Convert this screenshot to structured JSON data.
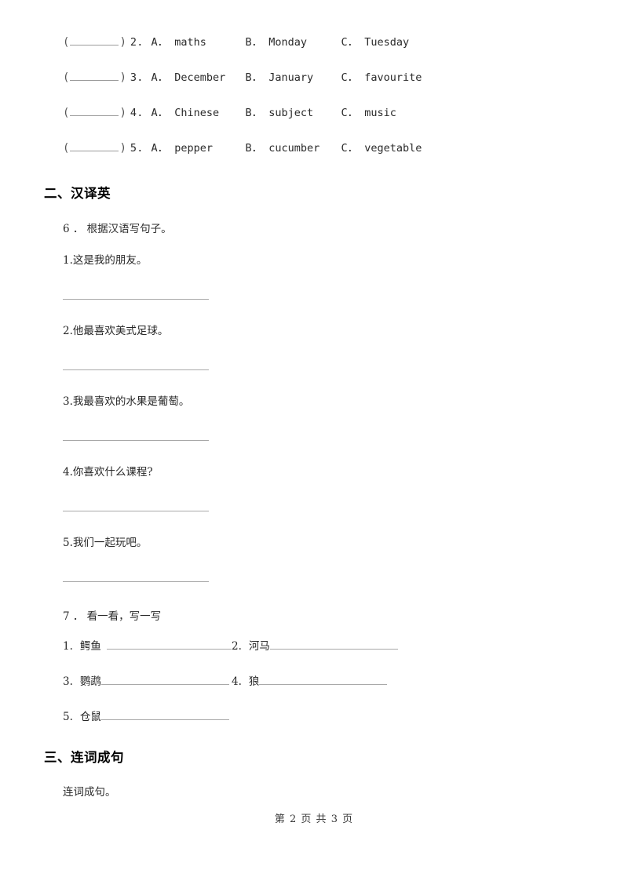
{
  "document": {
    "type": "worksheet",
    "footer": "第 2 页 共 3 页"
  },
  "multiple_choice": {
    "paren_open": "(",
    "paren_close": ")",
    "items": [
      {
        "number": "2.",
        "option_a": "A． maths",
        "option_b": "B． Monday",
        "option_c": "C． Tuesday"
      },
      {
        "number": "3.",
        "option_a": "A． December",
        "option_b": "B． January",
        "option_c": "C． favourite"
      },
      {
        "number": "4.",
        "option_a": "A． Chinese",
        "option_b": "B． subject",
        "option_c": "C． music"
      },
      {
        "number": "5.",
        "option_a": "A． pepper",
        "option_b": "B． cucumber",
        "option_c": "C． vegetable"
      }
    ]
  },
  "section_two": {
    "heading": "二、汉译英",
    "question_6": {
      "prompt": "6 ． 根据汉语写句子。",
      "sentences": [
        "1.这是我的朋友。",
        "2.他最喜欢美式足球。",
        "3.我最喜欢的水果是葡萄。",
        "4.你喜欢什么课程?",
        "5.我们一起玩吧。"
      ]
    },
    "question_7": {
      "prompt": "7 ． 看一看，写一写",
      "words": [
        {
          "number": "1.",
          "label": "鳄鱼"
        },
        {
          "number": "2.",
          "label": "河马"
        },
        {
          "number": "3.",
          "label": "鹦鹉"
        },
        {
          "number": "4.",
          "label": "狼"
        },
        {
          "number": "5.",
          "label": "仓鼠"
        }
      ]
    }
  },
  "section_three": {
    "heading": "三、连词成句",
    "prompt": "连词成句。"
  }
}
